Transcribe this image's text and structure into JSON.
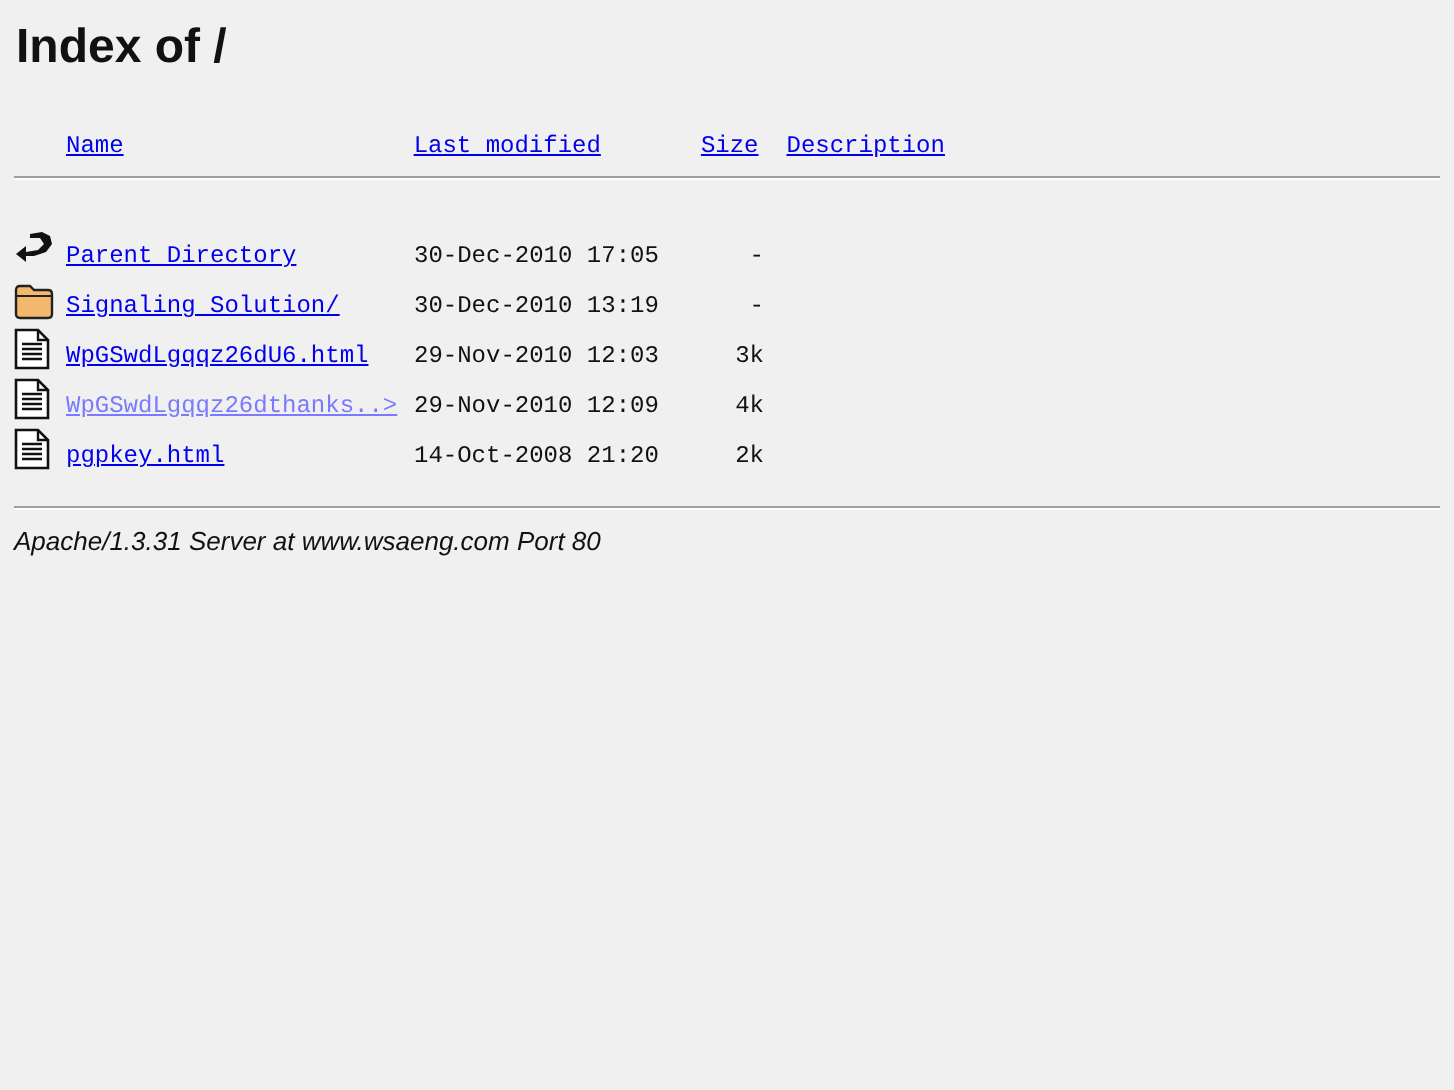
{
  "title": "Index of /",
  "columns": [
    "Name",
    "Last modified",
    "Size",
    "Description"
  ],
  "rows": [
    {
      "kind": "parent",
      "name": "Parent Directory",
      "modified": "30-Dec-2010 17:05",
      "size": "-",
      "visited": false
    },
    {
      "kind": "folder",
      "name": "Signaling Solution/",
      "modified": "30-Dec-2010 13:19",
      "size": "-",
      "visited": false
    },
    {
      "kind": "file",
      "name": "WpGSwdLgqqz26dU6.html",
      "modified": "29-Nov-2010 12:03",
      "size": "3k",
      "visited": false
    },
    {
      "kind": "file",
      "name": "WpGSwdLgqqz26dthanks..>",
      "modified": "29-Nov-2010 12:09",
      "size": "4k",
      "visited": true
    },
    {
      "kind": "file",
      "name": "pgpkey.html",
      "modified": "14-Oct-2008 21:20",
      "size": "2k",
      "visited": false
    }
  ],
  "footer": "Apache/1.3.31 Server at www.wsaeng.com Port 80"
}
